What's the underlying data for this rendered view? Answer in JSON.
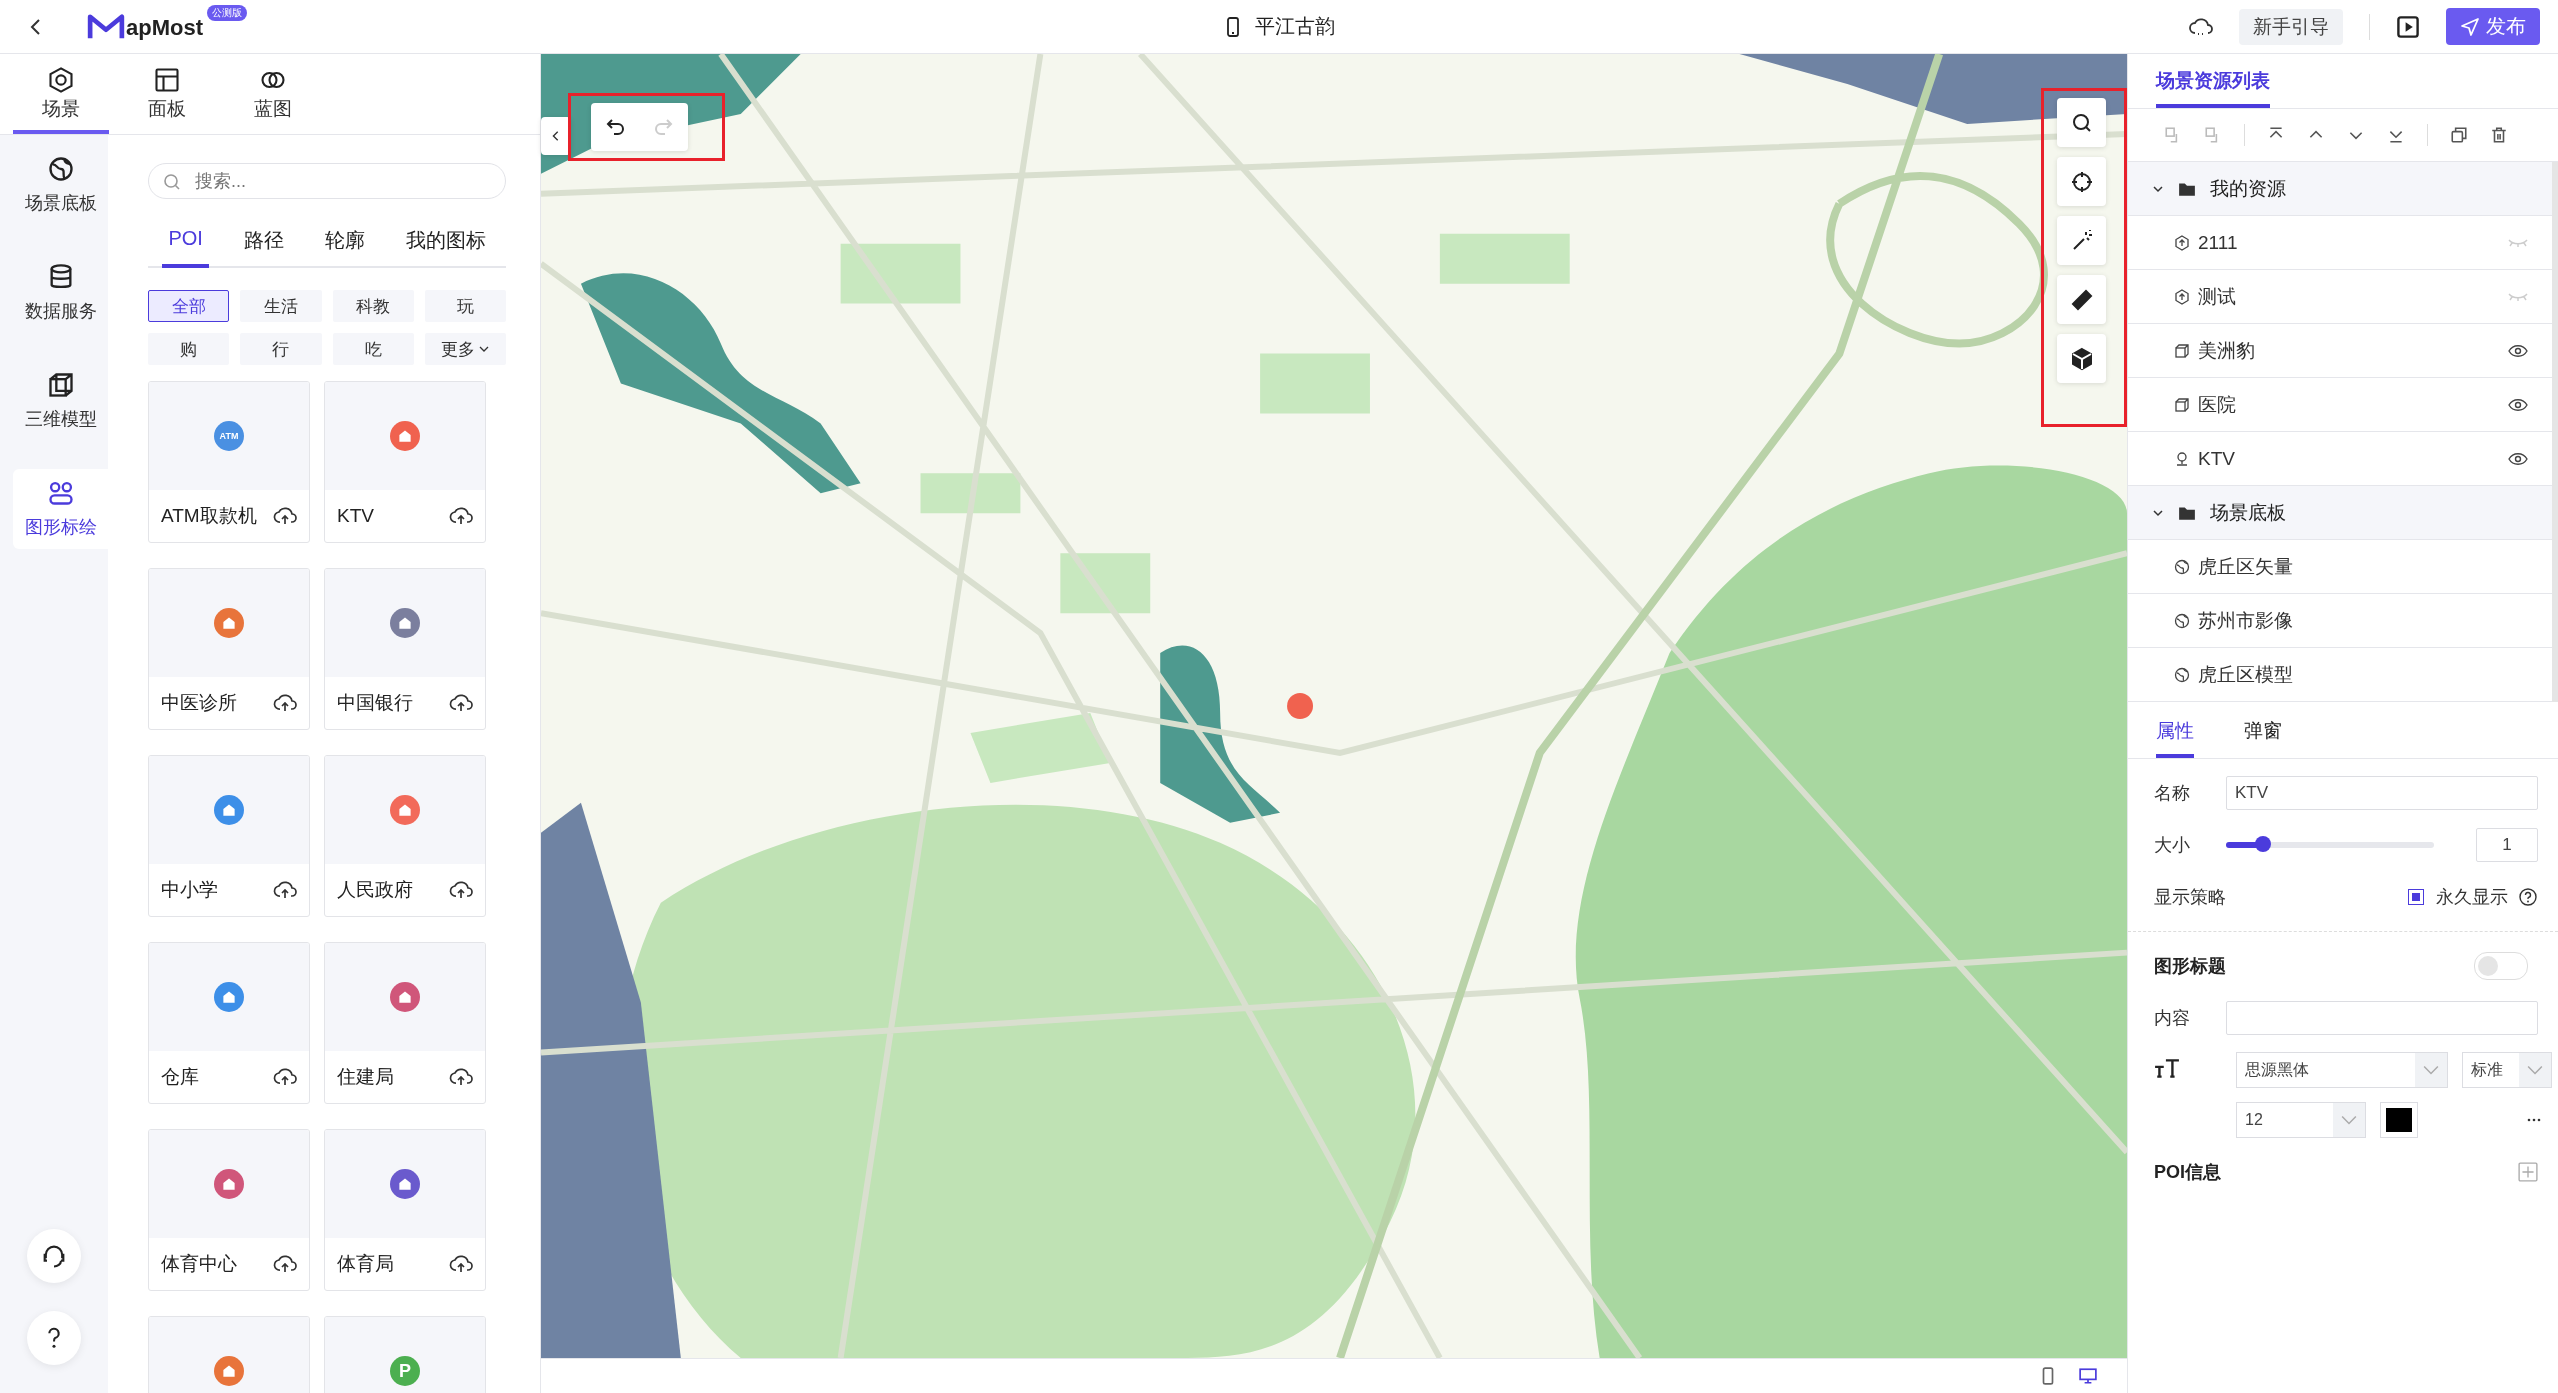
{
  "topbar": {
    "logo": "apMost",
    "badge": "公测版",
    "title": "平江古韵",
    "guide": "新手引导",
    "publish": "发布"
  },
  "top_tabs": [
    {
      "label": "场景",
      "selected": true
    },
    {
      "label": "面板",
      "selected": false
    },
    {
      "label": "蓝图",
      "selected": false
    }
  ],
  "rail": [
    {
      "label": "场景底板",
      "selected": false
    },
    {
      "label": "数据服务",
      "selected": false
    },
    {
      "label": "三维模型",
      "selected": false
    },
    {
      "label": "图形标绘",
      "selected": true
    }
  ],
  "search": {
    "placeholder": "搜索..."
  },
  "poi_tabs": [
    {
      "label": "POI",
      "selected": true
    },
    {
      "label": "路径",
      "selected": false
    },
    {
      "label": "轮廓",
      "selected": false
    },
    {
      "label": "我的图标",
      "selected": false
    }
  ],
  "filters": [
    {
      "label": "全部",
      "selected": true,
      "dropdown": false
    },
    {
      "label": "生活",
      "selected": false,
      "dropdown": false
    },
    {
      "label": "科教",
      "selected": false,
      "dropdown": false
    },
    {
      "label": "玩",
      "selected": false,
      "dropdown": false
    },
    {
      "label": "购",
      "selected": false,
      "dropdown": false
    },
    {
      "label": "行",
      "selected": false,
      "dropdown": false
    },
    {
      "label": "吃",
      "selected": false,
      "dropdown": false
    },
    {
      "label": "更多",
      "selected": false,
      "dropdown": true
    }
  ],
  "poi_cards": [
    {
      "label": "ATM取款机",
      "color": "#4a90e2",
      "glyph": "ATM"
    },
    {
      "label": "KTV",
      "color": "#f0624f"
    },
    {
      "label": "中医诊所",
      "color": "#e8743b"
    },
    {
      "label": "中国银行",
      "color": "#7b7f9e"
    },
    {
      "label": "中小学",
      "color": "#3d8fe8"
    },
    {
      "label": "人民政府",
      "color": "#f26a5a"
    },
    {
      "label": "仓库",
      "color": "#3d8fe8"
    },
    {
      "label": "住建局",
      "color": "#d0567a"
    },
    {
      "label": "体育中心",
      "color": "#d0567a"
    },
    {
      "label": "体育局",
      "color": "#6a5acd"
    },
    {
      "color": "#e8743b"
    },
    {
      "color": "#4caf50",
      "glyph": "P"
    }
  ],
  "history": [
    {
      "kind": "undo",
      "disabled": false
    },
    {
      "kind": "redo",
      "disabled": true
    }
  ],
  "map_tools": [
    {
      "kind": "search"
    },
    {
      "kind": "locate"
    },
    {
      "kind": "wand"
    },
    {
      "kind": "ruler"
    },
    {
      "kind": "cube"
    }
  ],
  "devices": [
    {
      "kind": "phone",
      "selected": false
    },
    {
      "kind": "desktop",
      "selected": true
    }
  ],
  "resources": {
    "title": "场景资源列表",
    "groups": [
      {
        "label": "我的资源",
        "expanded": true,
        "children": [
          {
            "label": "2111",
            "kind": "poi",
            "visible": false
          },
          {
            "label": "测试",
            "kind": "poi",
            "visible": false
          },
          {
            "label": "美洲豹",
            "kind": "model",
            "visible": true
          },
          {
            "label": "医院",
            "kind": "model",
            "visible": true
          },
          {
            "label": "KTV",
            "kind": "marker",
            "visible": true
          }
        ]
      },
      {
        "label": "场景底板",
        "expanded": true,
        "children": [
          {
            "label": "虎丘区矢量",
            "kind": "basemap"
          },
          {
            "label": "苏州市影像",
            "kind": "basemap"
          },
          {
            "label": "虎丘区模型",
            "kind": "basemap"
          }
        ]
      }
    ]
  },
  "prop_tabs": [
    {
      "label": "属性",
      "selected": true
    },
    {
      "label": "弹窗",
      "selected": false
    }
  ],
  "props": {
    "name_label": "名称",
    "name": "KTV",
    "size_label": "大小",
    "level": 0.18,
    "size": "1",
    "display_label": "显示策略",
    "always_show": {
      "label": "永久显示",
      "checked": true
    },
    "title_section": "图形标题",
    "title_on": false,
    "content_label": "内容",
    "font": "思源黑体",
    "weight": "标准",
    "font_size": "12",
    "color": "#000000",
    "poi_section": "POI信息"
  }
}
